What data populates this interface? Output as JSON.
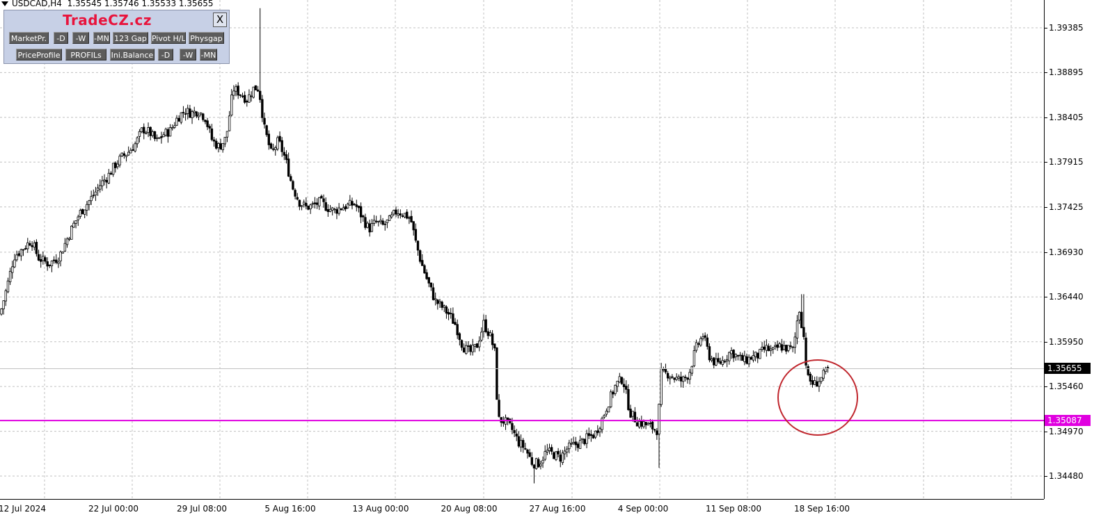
{
  "header": {
    "symbol": "USDCAD,H4",
    "ohlc": "1.35545 1.35746 1.35533 1.35655"
  },
  "panel": {
    "title": "TradeCZ.cz",
    "close_label": "X",
    "row1": [
      "MarketPr.",
      "-D",
      "-W",
      "-MN",
      "123 Gap",
      "Pivot H/L",
      "Physgap"
    ],
    "row2": [
      "PriceProfile",
      "PROFILs",
      "Ini.Balance",
      "-D",
      "-W",
      "-MN"
    ]
  },
  "price_axis": {
    "labels": [
      "1.39385",
      "1.38895",
      "1.38405",
      "1.37915",
      "1.37425",
      "1.36930",
      "1.36440",
      "1.35950",
      "1.35460",
      "1.34970",
      "1.34480"
    ],
    "current_price": "1.35655",
    "level_price": "1.35087"
  },
  "time_axis": {
    "labels": [
      "12 Jul 2024",
      "22 Jul 00:00",
      "29 Jul 08:00",
      "5 Aug 16:00",
      "13 Aug 00:00",
      "20 Aug 08:00",
      "27 Aug 16:00",
      "4 Sep 00:00",
      "11 Sep 08:00",
      "18 Sep 16:00"
    ]
  },
  "colors": {
    "background": "#ffffff",
    "grid": "#c0c0c0",
    "candle": "#000000",
    "bid_line": "#c0c0c0",
    "level_line": "#e000e0",
    "circle": "#c0262d",
    "badge_current_bg": "#000000",
    "badge_level_bg": "#e000e0"
  },
  "chart_data": {
    "type": "candlestick",
    "symbol": "USDCAD",
    "timeframe": "H4",
    "x_range": [
      "12 Jul 2024",
      "20 Sep 2024"
    ],
    "ylim": [
      1.343,
      1.3985
    ],
    "grid": true,
    "current_price": 1.35655,
    "horizontal_level": 1.35087,
    "close_path": [
      [
        0,
        1.3625
      ],
      [
        10,
        1.3655
      ],
      [
        20,
        1.3688
      ],
      [
        30,
        1.3695
      ],
      [
        45,
        1.3706
      ],
      [
        55,
        1.3687
      ],
      [
        70,
        1.368
      ],
      [
        85,
        1.3688
      ],
      [
        95,
        1.3705
      ],
      [
        105,
        1.3722
      ],
      [
        115,
        1.3736
      ],
      [
        125,
        1.3746
      ],
      [
        135,
        1.3756
      ],
      [
        145,
        1.3768
      ],
      [
        155,
        1.3776
      ],
      [
        165,
        1.3788
      ],
      [
        175,
        1.3797
      ],
      [
        185,
        1.3803
      ],
      [
        195,
        1.3812
      ],
      [
        205,
        1.3828
      ],
      [
        215,
        1.3824
      ],
      [
        225,
        1.3814
      ],
      [
        235,
        1.3822
      ],
      [
        245,
        1.3826
      ],
      [
        255,
        1.384
      ],
      [
        265,
        1.3848
      ],
      [
        275,
        1.3845
      ],
      [
        285,
        1.3848
      ],
      [
        295,
        1.384
      ],
      [
        305,
        1.3815
      ],
      [
        315,
        1.3808
      ],
      [
        325,
        1.3818
      ],
      [
        335,
        1.3872
      ],
      [
        345,
        1.3867
      ],
      [
        355,
        1.386
      ],
      [
        365,
        1.3873
      ],
      [
        372,
        1.3872
      ],
      [
        380,
        1.3828
      ],
      [
        390,
        1.38
      ],
      [
        400,
        1.3815
      ],
      [
        410,
        1.3795
      ],
      [
        420,
        1.3765
      ],
      [
        430,
        1.3748
      ],
      [
        440,
        1.3742
      ],
      [
        450,
        1.3744
      ],
      [
        460,
        1.3748
      ],
      [
        470,
        1.3742
      ],
      [
        480,
        1.3738
      ],
      [
        490,
        1.3742
      ],
      [
        500,
        1.3744
      ],
      [
        510,
        1.3746
      ],
      [
        520,
        1.3732
      ],
      [
        530,
        1.3718
      ],
      [
        540,
        1.3726
      ],
      [
        550,
        1.3722
      ],
      [
        560,
        1.3728
      ],
      [
        570,
        1.3738
      ],
      [
        580,
        1.3735
      ],
      [
        590,
        1.373
      ],
      [
        597,
        1.3705
      ],
      [
        605,
        1.3682
      ],
      [
        615,
        1.366
      ],
      [
        625,
        1.364
      ],
      [
        635,
        1.3633
      ],
      [
        645,
        1.3625
      ],
      [
        655,
        1.3613
      ],
      [
        665,
        1.359
      ],
      [
        675,
        1.3583
      ],
      [
        685,
        1.359
      ],
      [
        695,
        1.3615
      ],
      [
        705,
        1.36
      ],
      [
        712,
        1.358
      ],
      [
        715,
        1.351
      ],
      [
        725,
        1.3508
      ],
      [
        735,
        1.35
      ],
      [
        745,
        1.3485
      ],
      [
        755,
        1.3478
      ],
      [
        765,
        1.3462
      ],
      [
        775,
        1.3462
      ],
      [
        785,
        1.3475
      ],
      [
        795,
        1.3472
      ],
      [
        805,
        1.3468
      ],
      [
        815,
        1.3478
      ],
      [
        825,
        1.3482
      ],
      [
        835,
        1.3485
      ],
      [
        845,
        1.349
      ],
      [
        855,
        1.3494
      ],
      [
        865,
        1.351
      ],
      [
        875,
        1.353
      ],
      [
        885,
        1.3548
      ],
      [
        895,
        1.3555
      ],
      [
        905,
        1.3518
      ],
      [
        915,
        1.3508
      ],
      [
        925,
        1.3505
      ],
      [
        935,
        1.3502
      ],
      [
        945,
        1.3498
      ],
      [
        950,
        1.356
      ],
      [
        960,
        1.356
      ],
      [
        970,
        1.3555
      ],
      [
        980,
        1.3552
      ],
      [
        990,
        1.356
      ],
      [
        1000,
        1.3588
      ],
      [
        1010,
        1.3602
      ],
      [
        1020,
        1.3578
      ],
      [
        1030,
        1.357
      ],
      [
        1040,
        1.3575
      ],
      [
        1050,
        1.3585
      ],
      [
        1060,
        1.3578
      ],
      [
        1070,
        1.3574
      ],
      [
        1080,
        1.3578
      ],
      [
        1090,
        1.358
      ],
      [
        1100,
        1.3588
      ],
      [
        1110,
        1.3584
      ],
      [
        1120,
        1.359
      ],
      [
        1130,
        1.3588
      ],
      [
        1140,
        1.3586
      ],
      [
        1148,
        1.3633
      ],
      [
        1155,
        1.36
      ],
      [
        1160,
        1.3555
      ],
      [
        1170,
        1.3548
      ],
      [
        1180,
        1.3555
      ],
      [
        1190,
        1.3565
      ]
    ]
  }
}
